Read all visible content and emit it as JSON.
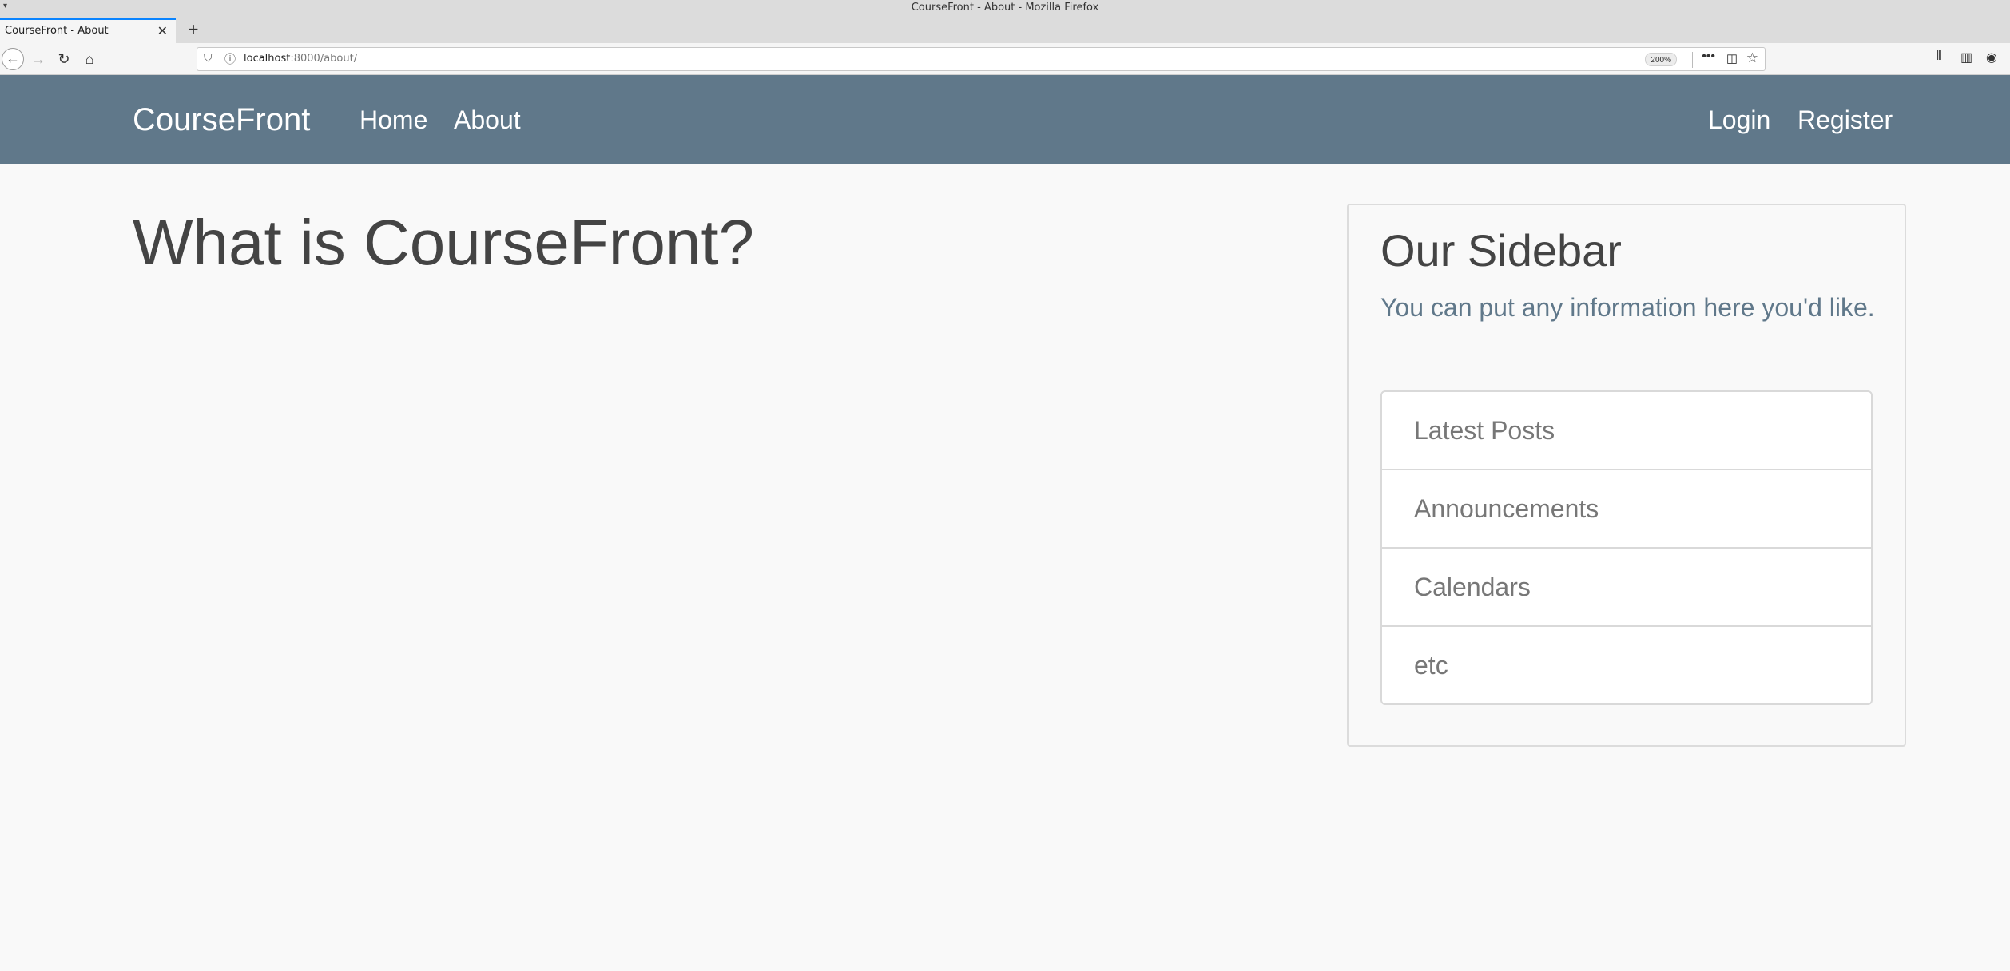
{
  "browser": {
    "window_title": "CourseFront - About - Mozilla Firefox",
    "tab_title": "CourseFront - About",
    "url_host": "localhost",
    "url_rest": ":8000/about/",
    "zoom": "200%"
  },
  "site": {
    "brand": "CourseFront",
    "nav_left": [
      "Home",
      "About"
    ],
    "nav_right": [
      "Login",
      "Register"
    ],
    "nav_color": "#60788a"
  },
  "main": {
    "heading": "What is CourseFront?"
  },
  "sidebar": {
    "title": "Our Sidebar",
    "text": "You can put any information here you'd like.",
    "items": [
      "Latest Posts",
      "Announcements",
      "Calendars",
      "etc"
    ]
  }
}
